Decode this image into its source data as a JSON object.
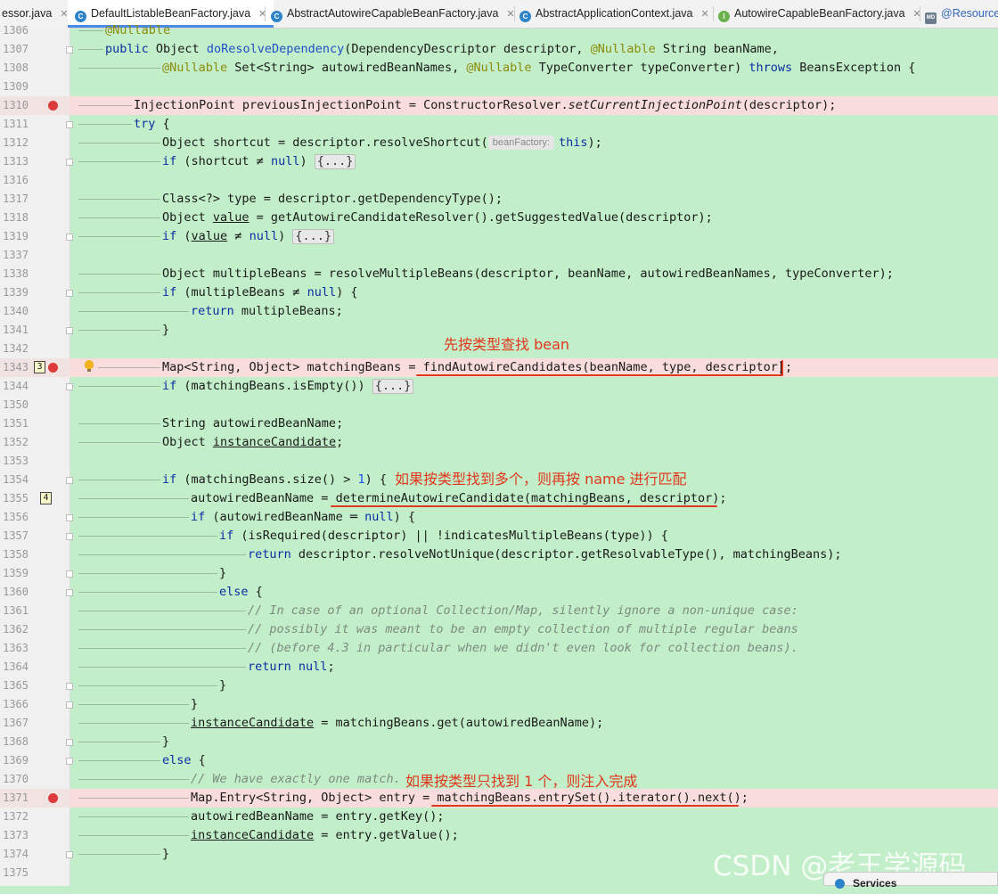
{
  "tabs": [
    {
      "label": "essor.java",
      "icon": "none",
      "active": false
    },
    {
      "label": "DefaultListableBeanFactory.java",
      "icon": "class-icon",
      "active": true
    },
    {
      "label": "AbstractAutowireCapableBeanFactory.java",
      "icon": "abstract-class-icon",
      "active": false
    },
    {
      "label": "AbstractApplicationContext.java",
      "icon": "abstract-class-icon",
      "active": false
    },
    {
      "label": "AutowireCapableBeanFactory.java",
      "icon": "interface-icon",
      "active": false
    },
    {
      "label": "@Resource",
      "icon": "markdown-icon",
      "active": false
    }
  ],
  "tab_icon_letters": {
    "class": "C",
    "interface": "I",
    "markdown": "MD"
  },
  "lines": [
    {
      "n": "1306"
    },
    {
      "n": "1307"
    },
    {
      "n": "1308"
    },
    {
      "n": "1309"
    },
    {
      "n": "1310",
      "breakpoint": true
    },
    {
      "n": "1311"
    },
    {
      "n": "1312"
    },
    {
      "n": "1313"
    },
    {
      "n": "1316"
    },
    {
      "n": "1317"
    },
    {
      "n": "1318"
    },
    {
      "n": "1319"
    },
    {
      "n": "1337"
    },
    {
      "n": "1338"
    },
    {
      "n": "1339"
    },
    {
      "n": "1340"
    },
    {
      "n": "1341"
    },
    {
      "n": "1342"
    },
    {
      "n": "1343",
      "breakpoint": true,
      "bookmark": "3"
    },
    {
      "n": "1344"
    },
    {
      "n": "1350"
    },
    {
      "n": "1351"
    },
    {
      "n": "1352"
    },
    {
      "n": "1353"
    },
    {
      "n": "1354"
    },
    {
      "n": "1355",
      "bookmark": "4"
    },
    {
      "n": "1356"
    },
    {
      "n": "1357"
    },
    {
      "n": "1358"
    },
    {
      "n": "1359"
    },
    {
      "n": "1360"
    },
    {
      "n": "1361"
    },
    {
      "n": "1362"
    },
    {
      "n": "1363"
    },
    {
      "n": "1364"
    },
    {
      "n": "1365"
    },
    {
      "n": "1366"
    },
    {
      "n": "1367"
    },
    {
      "n": "1368"
    },
    {
      "n": "1369"
    },
    {
      "n": "1370"
    },
    {
      "n": "1371",
      "breakpoint": true
    },
    {
      "n": "1372"
    },
    {
      "n": "1373"
    },
    {
      "n": "1374"
    },
    {
      "n": "1375"
    }
  ],
  "code": {
    "l1306": "@Nullable",
    "l1307_a": "public",
    "l1307_b": " Object ",
    "l1307_c": "doResolveDependency",
    "l1307_d": "(DependencyDescriptor descriptor, ",
    "l1307_e": "@Nullable",
    "l1307_f": " String beanName,",
    "l1308_a": "@Nullable",
    "l1308_b": " Set<String> autowiredBeanNames, ",
    "l1308_c": "@Nullable",
    "l1308_d": " TypeConverter typeConverter) ",
    "l1308_e": "throws",
    "l1308_f": " BeansException {",
    "l1310_a": "InjectionPoint previousInjectionPoint = ConstructorResolver.",
    "l1310_b": "setCurrentInjectionPoint",
    "l1310_c": "(descriptor);",
    "l1311_a": "try",
    "l1311_b": " {",
    "l1312_a": "Object shortcut = descriptor.resolveShortcut(",
    "l1312_hint": "beanFactory:",
    "l1312_b": "this",
    "l1312_c": ");",
    "l1313_a": "if",
    "l1313_b": " (shortcut ≠ ",
    "l1313_c": "null",
    "l1313_d": ") ",
    "l1313_fold": "{...}",
    "l1317": "Class<?> type = descriptor.getDependencyType();",
    "l1318_a": "Object ",
    "l1318_b": "value",
    "l1318_c": " = getAutowireCandidateResolver().getSuggestedValue(descriptor);",
    "l1319_a": "if",
    "l1319_b": " (",
    "l1319_c": "value",
    "l1319_d": " ≠ ",
    "l1319_e": "null",
    "l1319_f": ") ",
    "l1319_fold": "{...}",
    "l1338": "Object multipleBeans = resolveMultipleBeans(descriptor, beanName, autowiredBeanNames, typeConverter);",
    "l1339_a": "if",
    "l1339_b": " (multipleBeans ≠ ",
    "l1339_c": "null",
    "l1339_d": ") {",
    "l1340_a": "return",
    "l1340_b": " multipleBeans;",
    "l1341": "}",
    "l1343_a": "Map<String, Object> matchingBeans = ",
    "l1343_b": "findAutowireCandidates(beanName, type, descriptor);",
    "l1344_a": "if",
    "l1344_b": " (matchingBeans.isEmpty()) ",
    "l1344_fold": "{...}",
    "l1351": "String autowiredBeanName;",
    "l1352_a": "Object ",
    "l1352_b": "instanceCandidate",
    "l1352_c": ";",
    "l1354_a": "if",
    "l1354_b": " (matchingBeans.size() > ",
    "l1354_c": "1",
    "l1354_d": ") {",
    "l1355_a": "autowiredBeanName = ",
    "l1355_b": "determineAutowireCandidate(matchingBeans, descriptor);",
    "l1356_a": "if",
    "l1356_b": " (autowiredBeanName ═ ",
    "l1356_c": "null",
    "l1356_d": ") {",
    "l1357_a": "if",
    "l1357_b": " (isRequired(descriptor) || !indicatesMultipleBeans(type)) {",
    "l1358_a": "return",
    "l1358_b": " descriptor.resolveNotUnique(descriptor.getResolvableType(), matchingBeans);",
    "l1359": "}",
    "l1360_a": "else",
    "l1360_b": " {",
    "l1361": "// In case of an optional Collection/Map, silently ignore a non-unique case:",
    "l1362": "// possibly it was meant to be an empty collection of multiple regular beans",
    "l1363": "// (before 4.3 in particular when we didn't even look for collection beans).",
    "l1364_a": "return",
    "l1364_b": " ",
    "l1364_c": "null",
    "l1364_d": ";",
    "l1365": "}",
    "l1366": "}",
    "l1367_a": "instanceCandidate",
    "l1367_b": " = matchingBeans.get(autowiredBeanName);",
    "l1368": "}",
    "l1369_a": "else",
    "l1369_b": " {",
    "l1370": "// We have exactly one match.",
    "l1371_a": "Map.Entry<String, Object> entry = ",
    "l1371_b": "matchingBeans.entrySet().iterator().next();",
    "l1372": "autowiredBeanName = entry.getKey();",
    "l1373_a": "instanceCandidate",
    "l1373_b": " = entry.getValue();",
    "l1374": "}"
  },
  "annotations": {
    "by_type": "先按类型查找 bean",
    "multiple": "如果按类型找到多个，则再按 name 进行匹配",
    "single": "如果按类型只找到 1 个，则注入完成"
  },
  "watermark": "CSDN @老王学源码",
  "services_label": "Services",
  "colors": {
    "background": "#c2efc9",
    "breakpoint_line": "#f9dcdc",
    "breakpoint_dot": "#db3b3b",
    "annotation_red": "#e0371c",
    "keyword": "#0b2fa3"
  }
}
